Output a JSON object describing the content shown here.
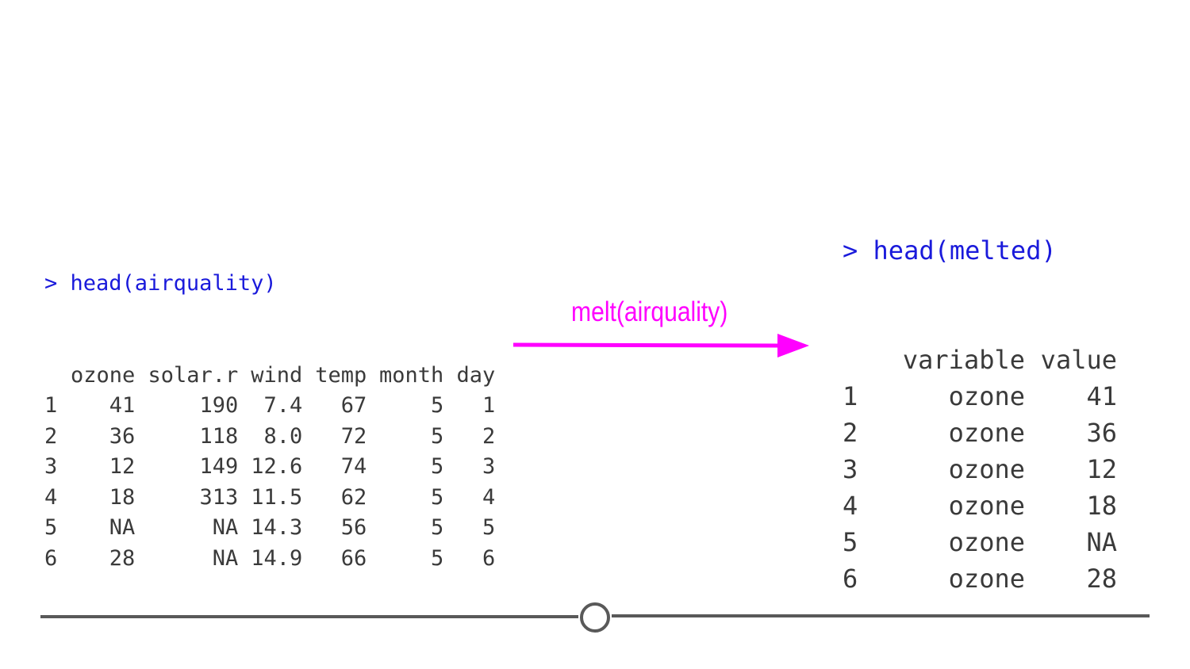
{
  "left": {
    "prompt": ">",
    "command": "head(airquality)",
    "columns": [
      "ozone",
      "solar.r",
      "wind",
      "temp",
      "month",
      "day"
    ],
    "rows": [
      [
        "1",
        "41",
        "190",
        "7.4",
        "67",
        "5",
        "1"
      ],
      [
        "2",
        "36",
        "118",
        "8.0",
        "72",
        "5",
        "2"
      ],
      [
        "3",
        "12",
        "149",
        "12.6",
        "74",
        "5",
        "3"
      ],
      [
        "4",
        "18",
        "313",
        "11.5",
        "62",
        "5",
        "4"
      ],
      [
        "5",
        "NA",
        "NA",
        "14.3",
        "56",
        "5",
        "5"
      ],
      [
        "6",
        "28",
        "NA",
        "14.9",
        "66",
        "5",
        "6"
      ]
    ]
  },
  "arrow": {
    "label": "melt(airquality)",
    "color": "#ff00ff"
  },
  "right": {
    "prompt": ">",
    "command": "head(melted)",
    "columns": [
      "variable",
      "value"
    ],
    "rows": [
      [
        "1",
        "ozone",
        "41"
      ],
      [
        "2",
        "ozone",
        "36"
      ],
      [
        "3",
        "ozone",
        "12"
      ],
      [
        "4",
        "ozone",
        "18"
      ],
      [
        "5",
        "ozone",
        "NA"
      ],
      [
        "6",
        "ozone",
        "28"
      ]
    ]
  },
  "colors": {
    "command": "#1a1adb",
    "output": "#3a3a3a",
    "divider": "#595959"
  }
}
